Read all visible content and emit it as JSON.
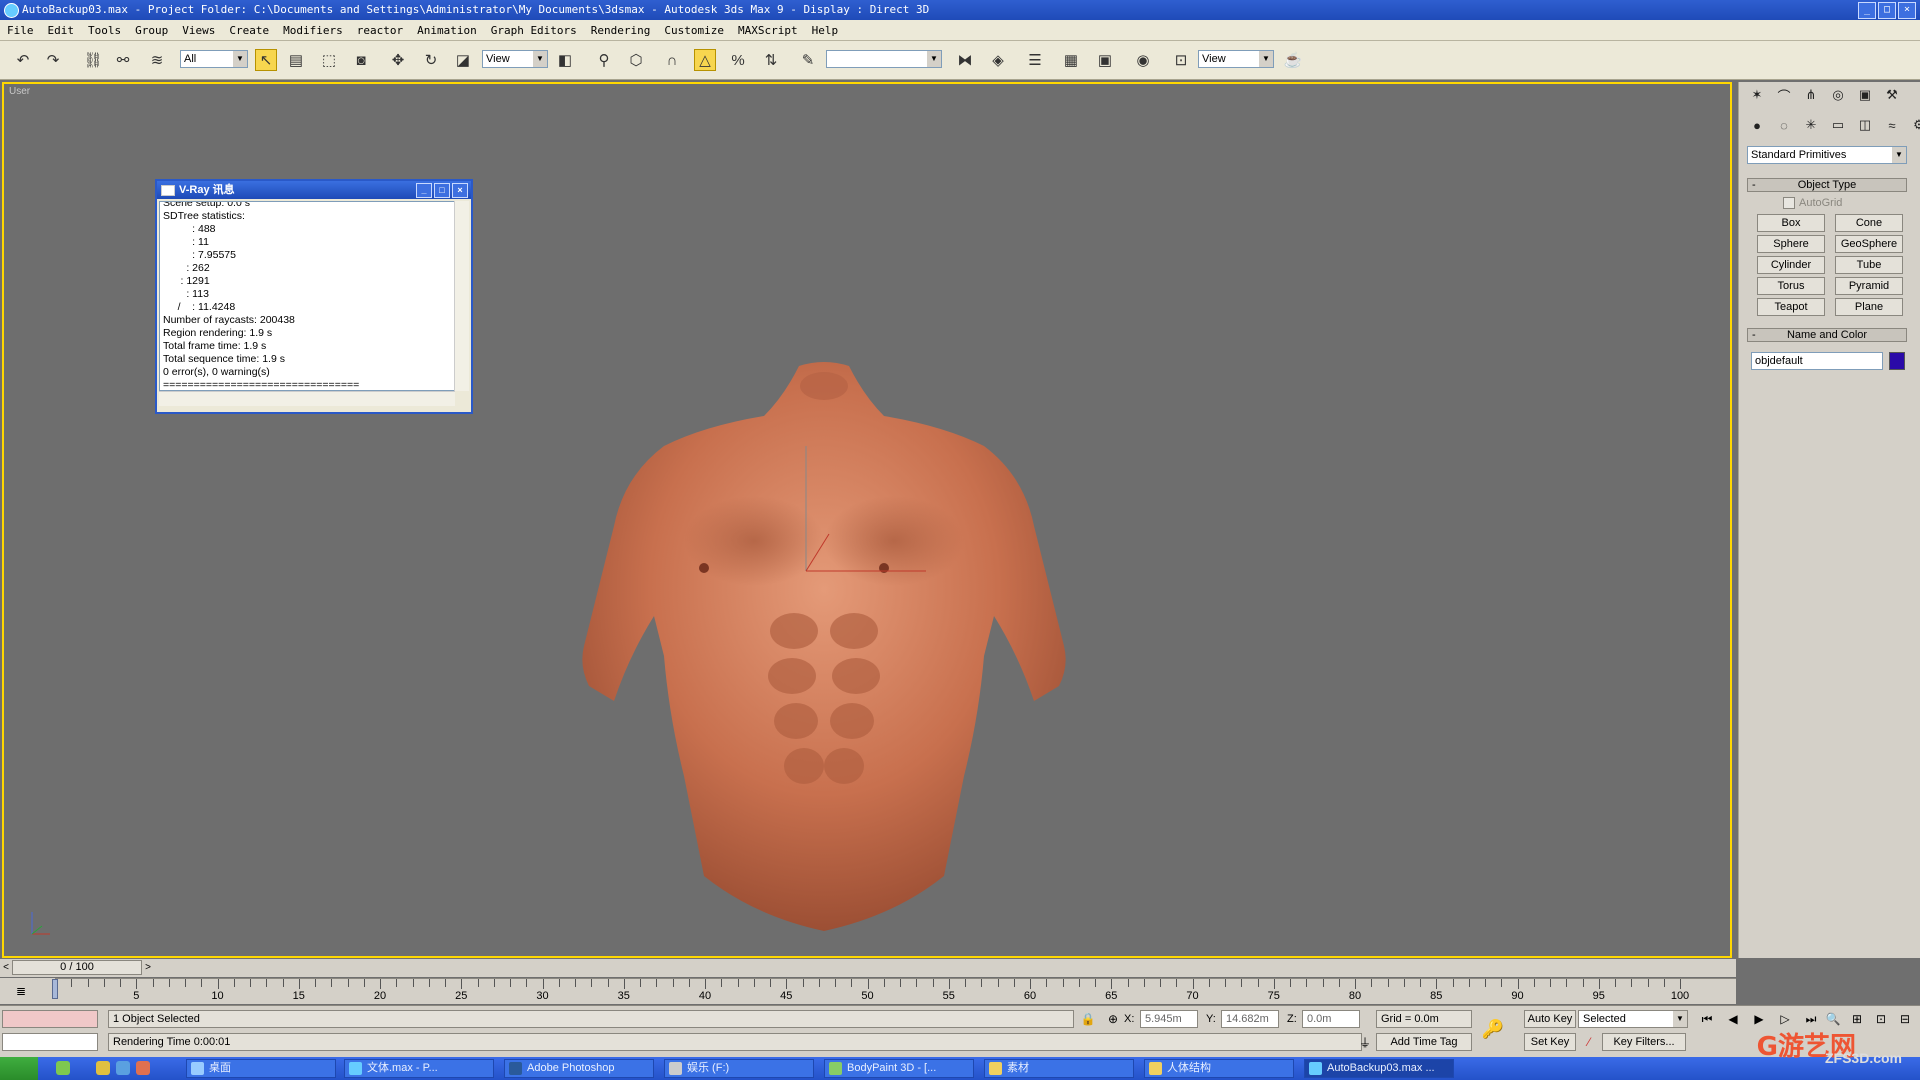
{
  "window": {
    "title": "AutoBackup03.max   - Project Folder: C:\\Documents and Settings\\Administrator\\My Documents\\3dsmax   - Autodesk 3ds Max 9   - Display : Direct 3D"
  },
  "menu": [
    "File",
    "Edit",
    "Tools",
    "Group",
    "Views",
    "Create",
    "Modifiers",
    "reactor",
    "Animation",
    "Graph Editors",
    "Rendering",
    "Customize",
    "MAXScript",
    "Help"
  ],
  "toolbar": {
    "selection_filter": "All",
    "ref_coord": "View",
    "named_selection": "",
    "render_view": "View"
  },
  "viewport": {
    "label": "User"
  },
  "vray_window": {
    "title": "V-Ray 讯息",
    "lines": [
      "Scene setup: 0.0 s",
      "SDTree statistics:",
      "          : 488",
      "          : 11",
      "          : 7.95575",
      "        : 262",
      "      : 1291",
      "        : 113",
      "     /    : 11.4248",
      "Number of raycasts: 200438",
      "Region rendering: 1.9 s",
      "Total frame time: 1.9 s",
      "Total sequence time: 1.9 s",
      "0 error(s), 0 warning(s)",
      "================================"
    ]
  },
  "command_panel": {
    "category": "Standard Primitives",
    "object_type_header": "Object Type",
    "autogrid": "AutoGrid",
    "buttons": [
      "Box",
      "Cone",
      "Sphere",
      "GeoSphere",
      "Cylinder",
      "Tube",
      "Torus",
      "Pyramid",
      "Teapot",
      "Plane"
    ],
    "name_color_header": "Name and Color",
    "object_name": "objdefault",
    "object_color": "#2a0aa8"
  },
  "timeline": {
    "frame_display": "0 / 100",
    "current_frame": 0,
    "ticks": [
      0,
      5,
      10,
      15,
      20,
      25,
      30,
      35,
      40,
      45,
      50,
      55,
      60,
      65,
      70,
      75,
      80,
      85,
      90,
      95,
      100
    ]
  },
  "status": {
    "selection": "1 Object Selected",
    "prompt": "Rendering Time  0:00:01",
    "x_label": "X:",
    "x_value": "5.945m",
    "y_label": "Y:",
    "y_value": "14.682m",
    "z_label": "Z:",
    "z_value": "0.0m",
    "grid": "Grid = 0.0m",
    "add_time_tag": "Add Time Tag",
    "auto_key": "Auto Key",
    "set_key": "Set Key",
    "key_mode": "Selected",
    "key_filters": "Key Filters..."
  },
  "taskbar": {
    "items": [
      "桌面",
      "文体.max   - P...",
      "Adobe Photoshop",
      "娱乐 (F:)",
      "BodyPaint 3D - [...",
      "素材",
      "人体结构",
      "AutoBackup03.max ..."
    ]
  },
  "watermark": {
    "text": "G游艺网",
    "sub": "ZFS3D.com"
  }
}
